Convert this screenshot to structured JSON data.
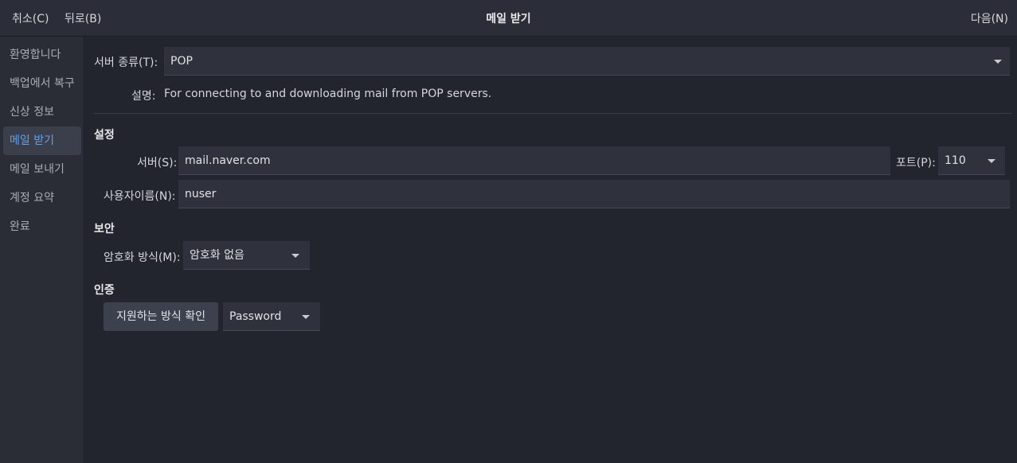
{
  "header": {
    "cancel_label": "취소(C)",
    "back_label": "뒤로(B)",
    "title": "메일 받기",
    "next_label": "다음(N)"
  },
  "sidebar": {
    "items": [
      {
        "label": "환영합니다"
      },
      {
        "label": "백업에서 복구"
      },
      {
        "label": "신상 정보"
      },
      {
        "label": "메일 받기",
        "active": true
      },
      {
        "label": "메일 보내기"
      },
      {
        "label": "계정 요약"
      },
      {
        "label": "완료"
      }
    ]
  },
  "form": {
    "server_type_label": "서버 종류(T):",
    "server_type_value": "POP",
    "description_label": "설명:",
    "description_value": "For connecting to and downloading mail from POP servers.",
    "settings_heading": "설정",
    "server_label": "서버(S):",
    "server_value": "mail.naver.com",
    "port_label": "포트(P):",
    "port_value": "110",
    "username_label": "사용자이름(N):",
    "username_value": "nuser",
    "security_heading": "보안",
    "encryption_label": "암호화 방식(M):",
    "encryption_value": "암호화 없음",
    "auth_heading": "인증",
    "check_auth_button": "지원하는 방식 확인",
    "auth_method_value": "Password"
  },
  "colors": {
    "accent": "#62a0ea",
    "background": "#22252e",
    "sidebar": "#2a2d36",
    "field": "#2f323c",
    "button": "#3d414d"
  }
}
